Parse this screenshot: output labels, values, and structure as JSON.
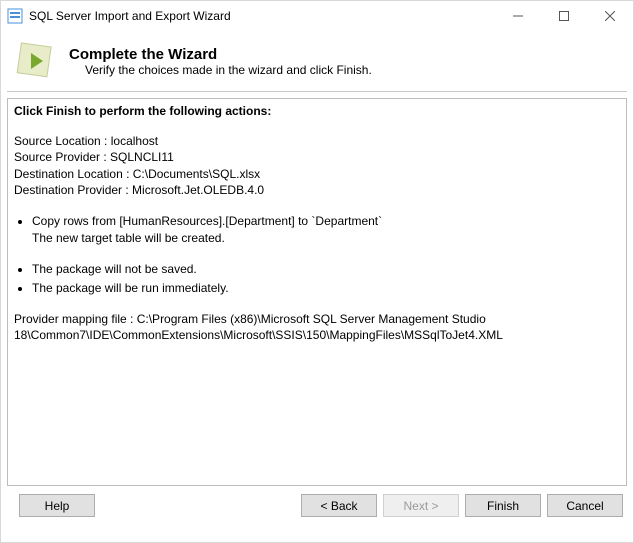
{
  "window": {
    "title": "SQL Server Import and Export Wizard"
  },
  "header": {
    "heading": "Complete the Wizard",
    "sub": "Verify the choices made in the wizard and click Finish."
  },
  "summary": {
    "intro": "Click Finish to perform the following actions:",
    "source_location": "Source Location : localhost",
    "source_provider": "Source Provider : SQLNCLI11",
    "destination_location": "Destination Location : C:\\Documents\\SQL.xlsx",
    "destination_provider": "Destination Provider : Microsoft.Jet.OLEDB.4.0",
    "copy_action": "Copy rows from [HumanResources].[Department] to `Department`",
    "copy_detail": "The new target table will be created.",
    "pkg_not_saved": "The package will not be saved.",
    "pkg_run_now": "The package will be run immediately.",
    "provider_mapping": "Provider mapping file : C:\\Program Files (x86)\\Microsoft SQL Server Management Studio 18\\Common7\\IDE\\CommonExtensions\\Microsoft\\SSIS\\150\\MappingFiles\\MSSqlToJet4.XML"
  },
  "buttons": {
    "help": "Help",
    "back": "< Back",
    "next": "Next >",
    "finish": "Finish",
    "cancel": "Cancel"
  }
}
